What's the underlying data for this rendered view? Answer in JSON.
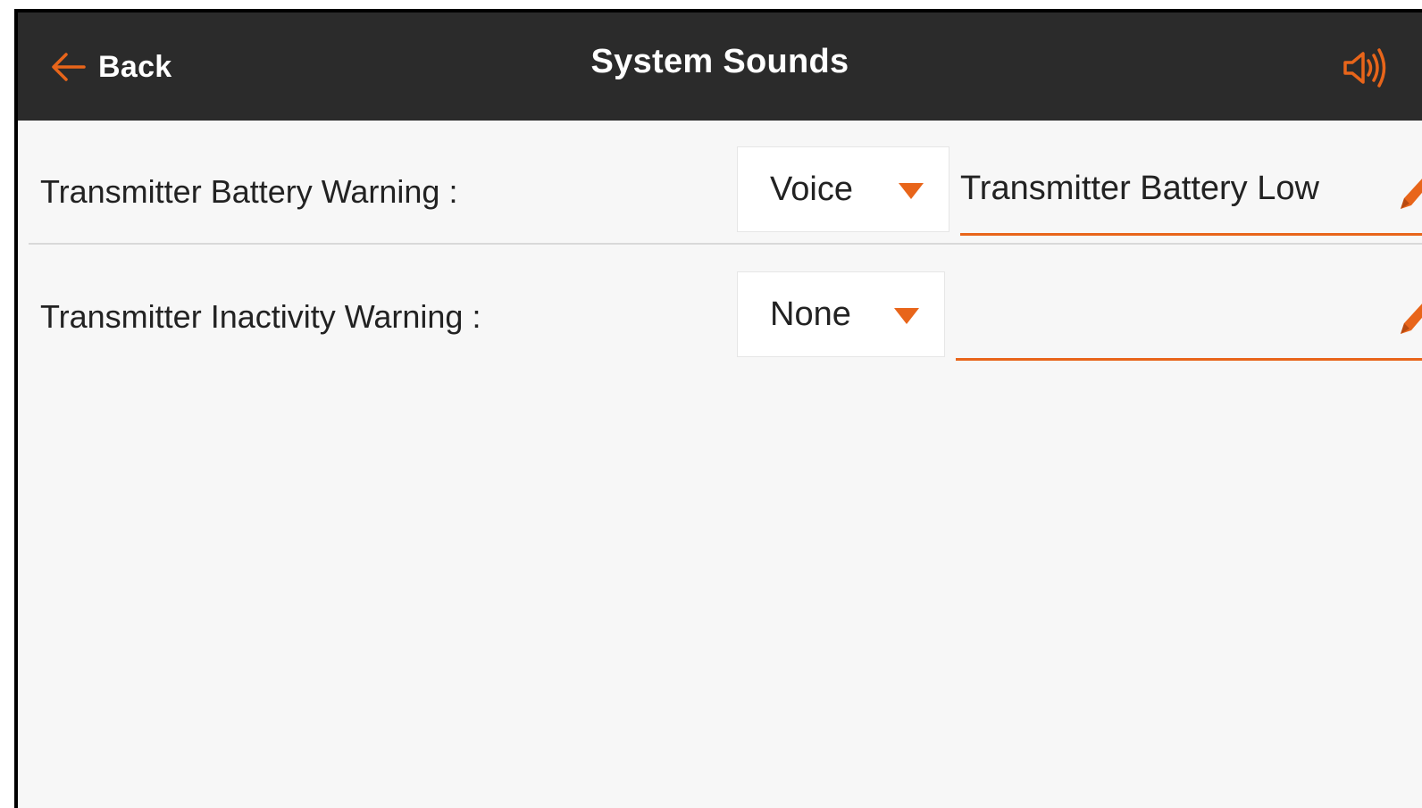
{
  "header": {
    "back_label": "Back",
    "title": "System Sounds",
    "back_icon": "arrow-left-icon",
    "sound_icon": "speaker-sound-icon"
  },
  "settings": [
    {
      "label": "Transmitter Battery Warning :",
      "mode": "Voice",
      "message": "Transmitter Battery Low"
    },
    {
      "label": "Transmitter Inactivity Warning :",
      "mode": "None",
      "message": ""
    }
  ],
  "colors": {
    "accent": "#e8651a",
    "header_bg": "#2b2b2b",
    "content_bg": "#f7f7f7",
    "text": "#222222"
  }
}
